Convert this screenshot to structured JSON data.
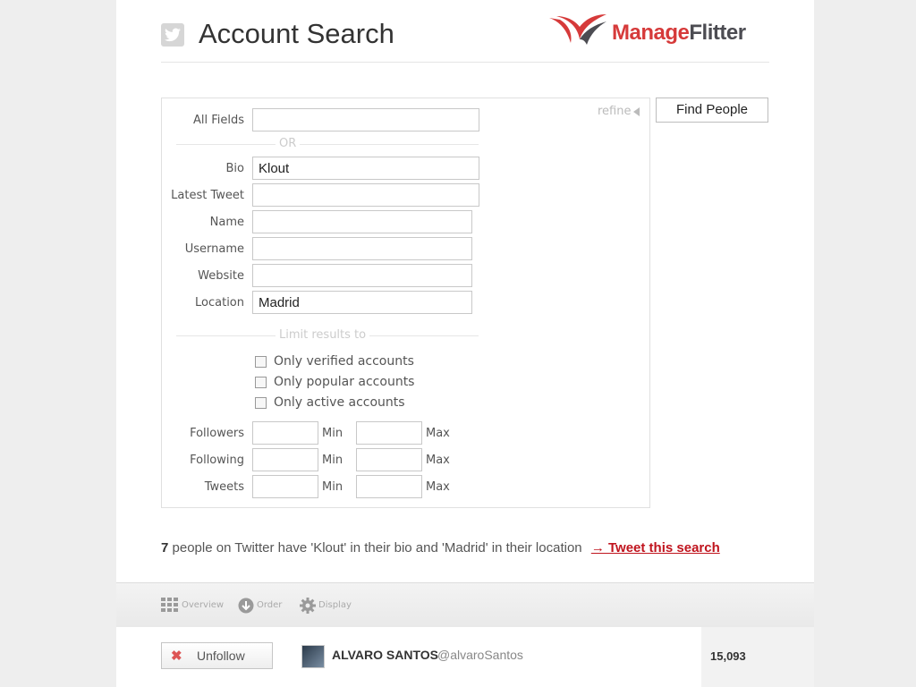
{
  "header": {
    "title": "Account Search",
    "logo": {
      "part1": "Manage",
      "part2": "Flitter"
    }
  },
  "search": {
    "refine_label": "refine",
    "find_button": "Find People",
    "fields": {
      "all_fields": {
        "label": "All Fields",
        "value": ""
      },
      "or_separator": "OR",
      "bio": {
        "label": "Bio",
        "value": "Klout"
      },
      "latest_tweet": {
        "label": "Latest Tweet",
        "value": ""
      },
      "name": {
        "label": "Name",
        "value": ""
      },
      "username": {
        "label": "Username",
        "value": ""
      },
      "website": {
        "label": "Website",
        "value": ""
      },
      "location": {
        "label": "Location",
        "value": "Madrid"
      }
    },
    "limit_separator": "Limit results to",
    "checkboxes": [
      {
        "label": "Only verified accounts",
        "checked": false
      },
      {
        "label": "Only popular accounts",
        "checked": false
      },
      {
        "label": "Only active accounts",
        "checked": false
      }
    ],
    "ranges": [
      {
        "label": "Followers",
        "min_label": "Min",
        "max_label": "Max",
        "min": "",
        "max": ""
      },
      {
        "label": "Following",
        "min_label": "Min",
        "max_label": "Max",
        "min": "",
        "max": ""
      },
      {
        "label": "Tweets",
        "min_label": "Min",
        "max_label": "Max",
        "min": "",
        "max": ""
      }
    ]
  },
  "summary": {
    "count": "7",
    "text": "people on Twitter have 'Klout' in their bio and 'Madrid' in their location",
    "tweet_link": "→ Tweet this search"
  },
  "toolbar": {
    "items": [
      {
        "label": "Overview",
        "icon": "grid-icon"
      },
      {
        "label": "Order",
        "icon": "arrow-down-circle-icon"
      },
      {
        "label": "Display",
        "icon": "gear-icon"
      }
    ]
  },
  "results": [
    {
      "action": "Unfollow",
      "name": "ALVARO SANTOS",
      "handle": "@alvaroSantos",
      "stat": "15,093"
    }
  ],
  "colors": {
    "link_red": "#c0141e",
    "logo_red": "#d63a3a",
    "logo_grey": "#4c4c52",
    "page_bg": "#eeeeee"
  }
}
